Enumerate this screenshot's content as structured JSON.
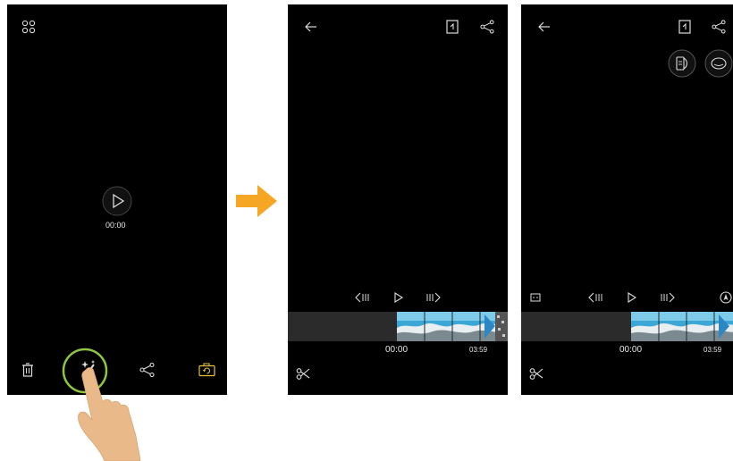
{
  "colors": {
    "screen_bg": "#000000",
    "arrow": "#f5a623",
    "highlight_ring": "#8dc63f",
    "accent_icon": "#e8c23a",
    "hand": "#e9b98a",
    "timeline_bg": "#2b2b2b"
  },
  "screen1": {
    "play_time": "00:00",
    "icons": [
      "grid-icon",
      "play-icon",
      "delete-icon",
      "magic-edit-icon",
      "share-icon",
      "rotate-icon"
    ]
  },
  "transition_icon": "right-arrow-icon",
  "screen2": {
    "time_start": "00:00",
    "time_end": "03:59",
    "icons": [
      "back-arrow-icon",
      "export-icon",
      "share-icon",
      "previous-frame-icon",
      "play-icon",
      "next-frame-icon",
      "scissors-icon"
    ]
  },
  "screen3": {
    "time_start": "00:00",
    "time_end": "03:59",
    "icons": [
      "back-arrow-icon",
      "export-icon",
      "share-icon",
      "portrait-mode-icon",
      "face-mode-icon",
      "aspect-icon",
      "previous-frame-icon",
      "play-icon",
      "next-frame-icon",
      "compass-icon",
      "scissors-icon"
    ]
  }
}
